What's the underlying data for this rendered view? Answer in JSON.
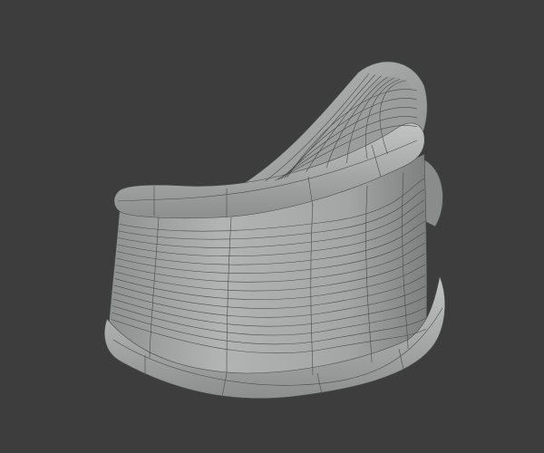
{
  "viewport": {
    "background_color": "#3d3d3d",
    "mesh_color": "#a9abab",
    "mesh_shadow_color": "#7c7e7e",
    "wire_color": "#4a4c4c"
  }
}
